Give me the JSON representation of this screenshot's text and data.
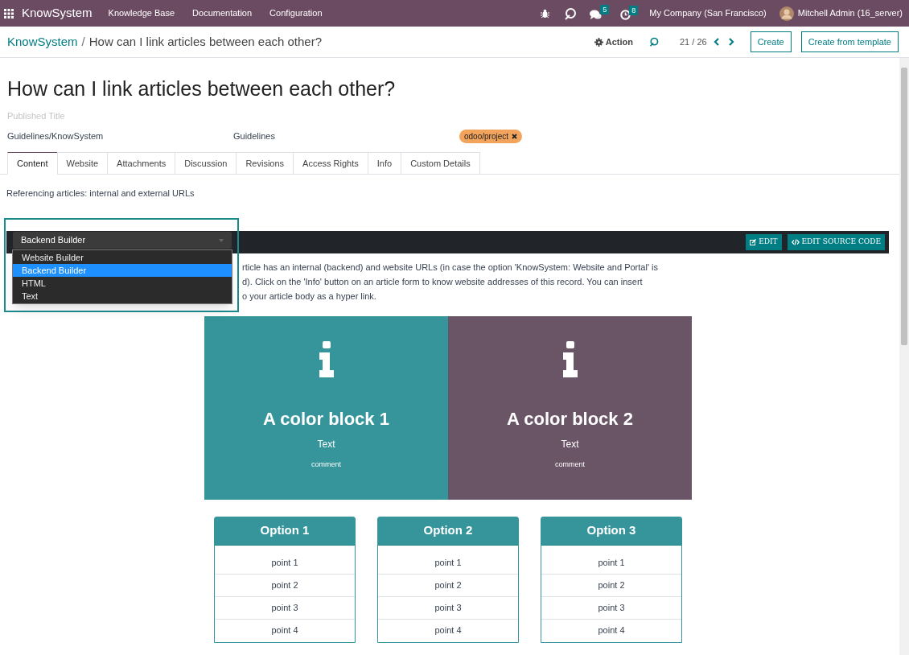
{
  "topbar": {
    "app_name": "KnowSystem",
    "menus": [
      "Knowledge Base",
      "Documentation",
      "Configuration"
    ],
    "messages_count": "5",
    "activities_count": "8",
    "company": "My Company (San Francisco)",
    "user": "Mitchell Admin (16_server)"
  },
  "control_panel": {
    "breadcrumb_root": "KnowSystem",
    "breadcrumb_separator": "/",
    "breadcrumb_current": "How can I link articles between each other?",
    "action": "Action",
    "pager": "21 / 26",
    "buttons": [
      "Create",
      "Create from template"
    ]
  },
  "form": {
    "title": "How can I link articles between each other?",
    "published_title_placeholder": "Published Title",
    "fields": [
      "Guidelines/KnowSystem",
      "Guidelines"
    ],
    "tag": "odoo/project"
  },
  "tabs": [
    {
      "label": "Content",
      "selected": true
    },
    {
      "label": "Website",
      "selected": false
    },
    {
      "label": "Attachments",
      "selected": false
    },
    {
      "label": "Discussion",
      "selected": false
    },
    {
      "label": "Revisions",
      "selected": false
    },
    {
      "label": "Access Rights",
      "selected": false
    },
    {
      "label": "Info",
      "selected": false
    },
    {
      "label": "Custom Details",
      "selected": false
    }
  ],
  "content": {
    "subtitle": "Referencing articles: internal and external URLs",
    "editor_mode": {
      "value": "Backend Builder",
      "options": [
        {
          "label": "Website Builder",
          "selected": false
        },
        {
          "label": "Backend Builder",
          "selected": true
        },
        {
          "label": "HTML",
          "selected": false
        },
        {
          "label": "Text",
          "selected": false
        }
      ]
    },
    "toolbar_buttons": [
      {
        "kind": "edit",
        "label": "EDIT"
      },
      {
        "kind": "source",
        "label": "EDIT SOURCE CODE"
      }
    ],
    "paragraph_lines": [
      "rticle has an internal (backend) and website URLs (in case the option 'KnowSystem: Website and Portal' is",
      "d). Click on the 'Info' button on an article form to know website addresses of this record. You can insert",
      "o your article body as a hyper link."
    ],
    "color_blocks": [
      {
        "title": "A color block 1",
        "text": "Text",
        "comment": "comment",
        "color": "#35959a"
      },
      {
        "title": "A color block 2",
        "text": "Text",
        "comment": "comment",
        "color": "#6a5566"
      }
    ],
    "options": [
      {
        "title": "Option 1",
        "points": [
          "point 1",
          "point 2",
          "point 3",
          "point 4"
        ]
      },
      {
        "title": "Option 2",
        "points": [
          "point 1",
          "point 2",
          "point 3",
          "point 4"
        ]
      },
      {
        "title": "Option 3",
        "points": [
          "point 1",
          "point 2",
          "point 3",
          "point 4"
        ]
      }
    ]
  }
}
